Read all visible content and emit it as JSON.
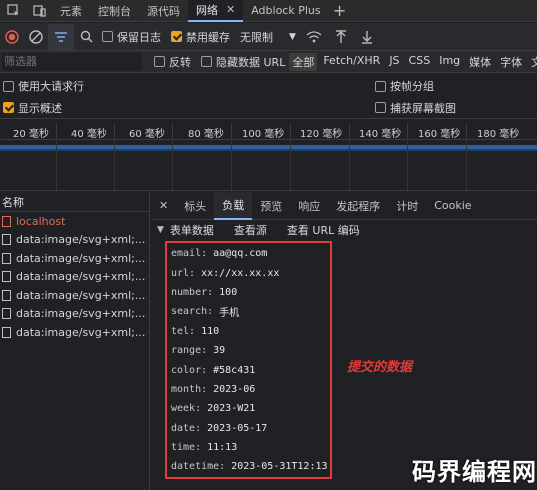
{
  "tabs": {
    "items": [
      {
        "label": "元素"
      },
      {
        "label": "控制台"
      },
      {
        "label": "源代码"
      },
      {
        "label": "网络"
      },
      {
        "label": "Adblock Plus"
      }
    ],
    "add": "+"
  },
  "toolbar": {
    "preserve_log": "保留日志",
    "disable_cache": "禁用缓存",
    "throttle": "无限制"
  },
  "filterbar": {
    "placeholder": "筛选器",
    "invert": "反转",
    "hide_data_urls": "隐藏数据 URL",
    "types": [
      "全部",
      "Fetch/XHR",
      "JS",
      "CSS",
      "Img",
      "媒体",
      "字体",
      "文档"
    ]
  },
  "options": {
    "big_rows": "使用大请求行",
    "group_by_frame": "按帧分组",
    "show_overview": "显示概述",
    "capture_screenshots": "捕获屏幕截图"
  },
  "timeline": {
    "ticks": [
      "20 毫秒",
      "40 毫秒",
      "60 毫秒",
      "80 毫秒",
      "100 毫秒",
      "120 毫秒",
      "140 毫秒",
      "160 毫秒",
      "180 毫秒"
    ]
  },
  "requests": {
    "header": "名称",
    "items": [
      {
        "name": "localhost"
      },
      {
        "name": "data:image/svg+xml;..."
      },
      {
        "name": "data:image/svg+xml;..."
      },
      {
        "name": "data:image/svg+xml;..."
      },
      {
        "name": "data:image/svg+xml;..."
      },
      {
        "name": "data:image/svg+xml;..."
      },
      {
        "name": "data:image/svg+xml;..."
      }
    ]
  },
  "detail": {
    "close": "✕",
    "tabs": [
      "标头",
      "负载",
      "预览",
      "响应",
      "发起程序",
      "计时",
      "Cookie"
    ],
    "form_title": "表单数据",
    "view_source": "查看源",
    "view_url_encoded": "查看 URL 编码",
    "fields": [
      {
        "key": "email:",
        "value": "aa@qq.com"
      },
      {
        "key": "url:",
        "value": "xx://xx.xx.xx"
      },
      {
        "key": "number:",
        "value": "100"
      },
      {
        "key": "search:",
        "value": "手机"
      },
      {
        "key": "tel:",
        "value": "110"
      },
      {
        "key": "range:",
        "value": "39"
      },
      {
        "key": "color:",
        "value": "#58c431"
      },
      {
        "key": "month:",
        "value": "2023-06"
      },
      {
        "key": "week:",
        "value": "2023-W21"
      },
      {
        "key": "date:",
        "value": "2023-05-17"
      },
      {
        "key": "time:",
        "value": "11:13"
      },
      {
        "key": "datetime:",
        "value": "2023-05-31T12:13"
      }
    ]
  },
  "annotation": "提交的数据",
  "watermark": "码界编程网",
  "colors": {
    "accent": "#8ab4f8",
    "highlight": "#e23a3a",
    "checkbox": "#f0a21b"
  }
}
